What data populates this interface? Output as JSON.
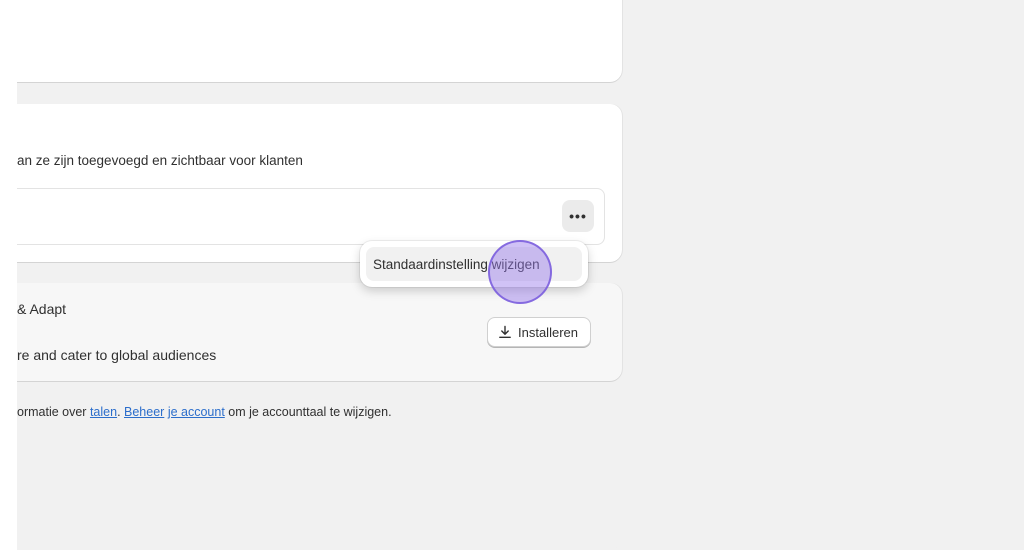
{
  "languages_card": {
    "description": "an ze zijn toegevoegd en zichtbaar voor klanten",
    "more_actions_label": "•••"
  },
  "popover": {
    "change_default_label": "Standaardinstelling wijzigen"
  },
  "app_card": {
    "title": "& Adapt",
    "description": "re and cater to global audiences",
    "install_label": "Installeren"
  },
  "footer": {
    "text_before": "ormatie over ",
    "link_languages": "talen",
    "separator": ". ",
    "link_manage": "Beheer",
    "space": " ",
    "link_account": "je account",
    "text_after": " om je accounttaal te wijzigen."
  },
  "icons": {
    "install": "download-icon",
    "more": "ellipsis-icon"
  }
}
